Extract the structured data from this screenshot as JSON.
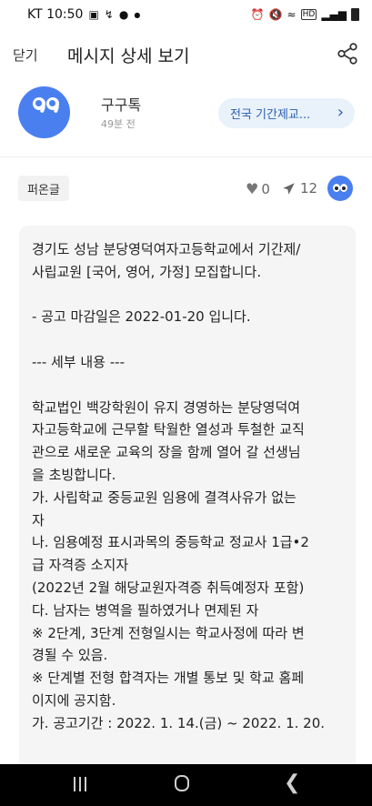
{
  "status_bar": {
    "carrier_time": "KT 10:50",
    "icons": [
      "photo-icon",
      "data-saver-icon",
      "chat-icon",
      "dot-icon"
    ],
    "right_icons": [
      "alarm-icon",
      "mute-icon",
      "wifi-icon",
      "hd-icon",
      "signal-icon",
      "battery-icon"
    ],
    "hd_label": "HD"
  },
  "header": {
    "close_label": "닫기",
    "title": "메시지 상세 보기",
    "share_icon": "share-icon"
  },
  "sender": {
    "name": "구구톡",
    "time": "49분 전",
    "channel_label": "전국 기간제교...",
    "channel_icon": "chevron-right-icon"
  },
  "meta": {
    "repost_label": "퍼온글",
    "likes": "0",
    "shares": "12"
  },
  "message": {
    "lines": [
      "경기도 성남 분당영덕여자고등학교에서 기간제/",
      "사립교원 [국어, 영어, 가정] 모집합니다.",
      "",
      "- 공고 마감일은 2022-01-20 입니다.",
      "",
      "--- 세부 내용 ---",
      "",
      "학교법인 백강학원이 유지 경영하는 분당영덕여",
      "자고등학교에 근무할 탁월한 열성과 투철한 교직",
      "관으로 새로운 교육의 장을 함께 열어 갈 선생님",
      "을 초빙합니다.",
      "가. 사립학교 중등교원 임용에 결격사유가 없는",
      "자",
      "나. 임용예정 표시과목의 중등학교 정교사 1급•2",
      "급 자격증 소지자",
      "(2022년 2월 해당교원자격증 취득예정자 포함)",
      "다. 남자는 병역을 필하였거나 면제된 자",
      "※ 2단계, 3단계 전형일시는 학교사정에 따라 변",
      "경될 수 있음.",
      "※ 단계별 전형 합격자는 개별 통보 및 학교 홈페",
      "이지에 공지함.",
      "가. 공고기간 : 2022. 1. 14.(금)  ~  2022. 1. 20."
    ]
  },
  "nav": {
    "recent_icon": "recent-apps-icon",
    "home_icon": "home-icon",
    "back_icon": "back-icon"
  }
}
